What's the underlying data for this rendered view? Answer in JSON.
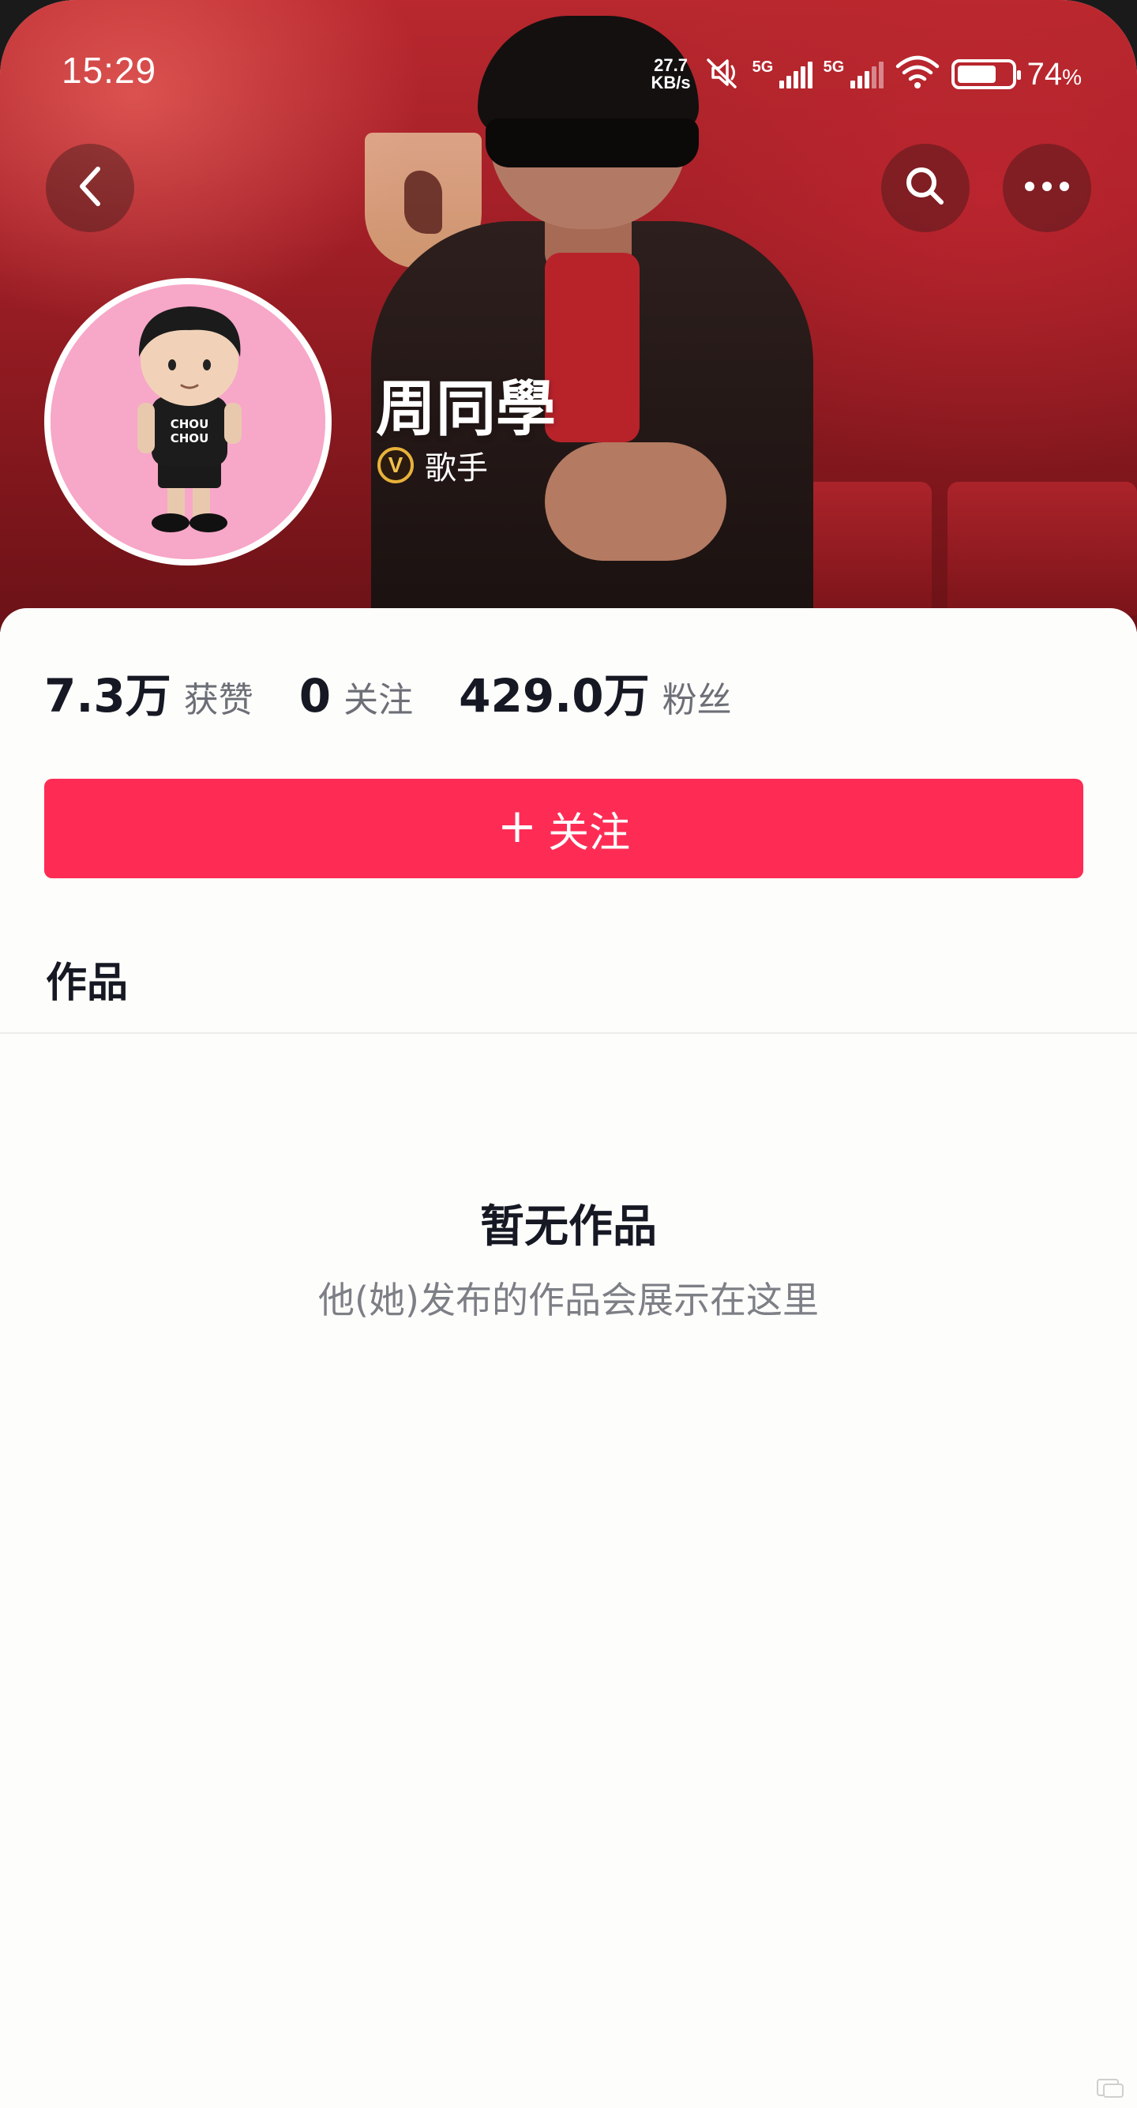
{
  "status_bar": {
    "time": "15:29",
    "net_speed_value": "27.7",
    "net_speed_unit": "KB/s",
    "sim1_tag": "5G",
    "sim2_tag": "5G",
    "battery_percent": "74",
    "battery_unit": "%",
    "battery_level": 0.74,
    "icons": [
      "mute-icon",
      "signal-icon",
      "wifi-icon",
      "battery-icon"
    ]
  },
  "nav": {
    "back_icon": "chevron-left-icon",
    "search_icon": "search-icon",
    "more_icon": "more-horizontal-icon"
  },
  "profile": {
    "nickname": "周同學",
    "verify_badge": "V",
    "verify_label": "歌手",
    "avatar_text": "CHOU CHOU"
  },
  "stats": [
    {
      "value": "7.3万",
      "label": "获赞"
    },
    {
      "value": "0",
      "label": "关注"
    },
    {
      "value": "429.0万",
      "label": "粉丝"
    }
  ],
  "follow_button": {
    "plus": "+",
    "label": "关注"
  },
  "tabs": {
    "works": "作品"
  },
  "empty_state": {
    "title": "暂无作品",
    "subtitle": "他(她)发布的作品会展示在这里"
  },
  "colors": {
    "accent": "#fe2c55",
    "banner_red": "#a31f27",
    "avatar_bg": "#f7a7c8",
    "text_primary": "#161823",
    "text_secondary": "#6d6f77"
  }
}
